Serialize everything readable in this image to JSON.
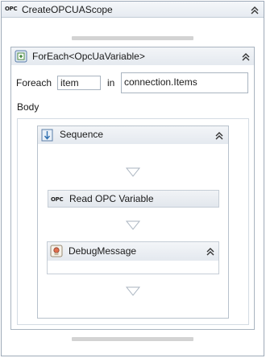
{
  "scope": {
    "title": "CreateOPCUAScope",
    "icon": "opc-logo-icon",
    "logo_text": "OPC"
  },
  "foreach": {
    "title": "ForEach<OpcUaVariable>",
    "icon": "foreach-icon",
    "foreach_label": "Foreach",
    "item_value": "item",
    "in_label": "in",
    "collection_value": "connection.Items",
    "body_label": "Body"
  },
  "sequence": {
    "title": "Sequence",
    "icon": "sequence-icon"
  },
  "read_opc": {
    "title": "Read OPC Variable",
    "icon": "opc-logo-icon",
    "logo_text": "OPC"
  },
  "debug": {
    "title": "DebugMessage",
    "icon": "debug-message-icon"
  },
  "colors": {
    "border": "#9eaab8",
    "header": "#e6ebf1",
    "drop_arrow": "#a8b3bf"
  }
}
